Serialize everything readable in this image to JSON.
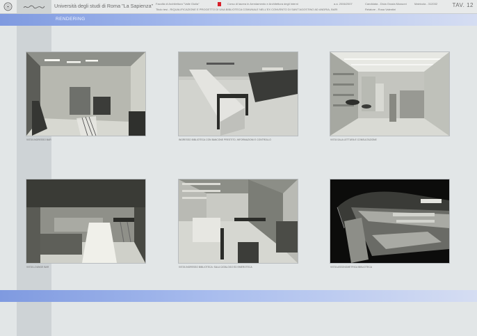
{
  "header": {
    "university": "Università degli studi di Roma \"La Sapienza\"",
    "faculty": "Facoltà di Architettura \"Valle Giulia\"",
    "course": "Corso di laurea in Arredamento e Architettura degli Interni",
    "thesis": "Titolo tesi - RIQUALIFICAZIONE E PROGETTO DI UNA BIBLIOTECA COMUNALE NELL'EX CONVENTO DI SANT'AGOSTINO AD ANDRIA, BARI",
    "year": "a.a. 2006/2007",
    "candidate": "Candidata - Dicia Grazia Mussoni",
    "matricola": "Matricola - 312032",
    "relatore": "Relatore - Rosa Valentini",
    "tav": "TAV. 12",
    "accent_color": "#d8202a"
  },
  "section": {
    "title": "RENDERING"
  },
  "renders": [
    {
      "caption": "VISTA INGRESSO BAR"
    },
    {
      "caption": "INGRESSO BIBLIOTECA CON BANCONE PRESTITO, INFORMAZIONI E CONTROLLO"
    },
    {
      "caption": "VISTA SALA LETTURA E CONSULTAZIONE"
    },
    {
      "caption": "VISTA LOUNGE BAR"
    },
    {
      "caption": "VISTA INGRESSO BIBLIOTECA: SALA CATALOGO ED EMEROTECA"
    },
    {
      "caption": "VISTA ASSONOMETRICA BIBLIOTECA"
    }
  ]
}
